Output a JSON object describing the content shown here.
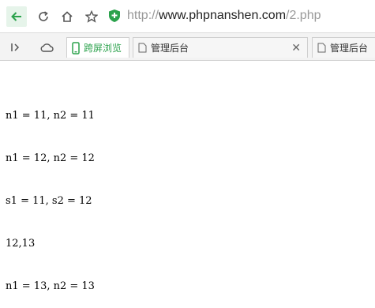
{
  "toolbar": {
    "url_protocol": "http://",
    "url_host": "www.phpnanshen.com",
    "url_path": "/2.php",
    "icons": [
      "back-arrow-icon",
      "reload-icon",
      "home-icon",
      "star-icon",
      "shield-icon"
    ],
    "accent": "#2ba24c"
  },
  "tabs": [
    {
      "label": "跨屏浏览",
      "active": true
    },
    {
      "label": "管理后台",
      "active": false
    },
    {
      "label": "管理后台",
      "active": false
    }
  ],
  "content": {
    "lines": [
      "n1 = 11, n2 = 11",
      "n1 = 12, n2 = 12",
      "s1 = 11, s2 = 12",
      "12,13",
      "n1 = 13, n2 = 13"
    ]
  }
}
